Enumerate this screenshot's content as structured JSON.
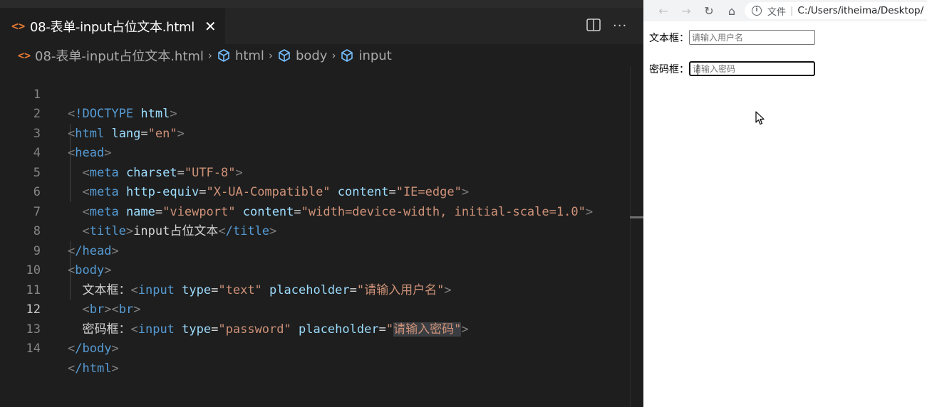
{
  "editor": {
    "tab": {
      "label": "08-表单-input占位文本.html",
      "close": "✕",
      "icon": "<>"
    },
    "more": "···",
    "breadcrumb": {
      "file_icon": "<>",
      "file": "08-表单-input占位文本.html",
      "sep": "›",
      "items": [
        "html",
        "body",
        "input"
      ]
    },
    "lines": [
      {
        "n": "1"
      },
      {
        "n": "2"
      },
      {
        "n": "3"
      },
      {
        "n": "4"
      },
      {
        "n": "5"
      },
      {
        "n": "6"
      },
      {
        "n": "7"
      },
      {
        "n": "8"
      },
      {
        "n": "9"
      },
      {
        "n": "10"
      },
      {
        "n": "11"
      },
      {
        "n": "12"
      },
      {
        "n": "13"
      },
      {
        "n": "14"
      }
    ],
    "code": {
      "l1": {
        "tag": "!DOCTYPE",
        "attr": "html"
      },
      "l2": {
        "tag": "html",
        "attr": "lang",
        "val": "\"en\""
      },
      "l3": {
        "tag": "head"
      },
      "l4": {
        "tag": "meta",
        "attr": "charset",
        "val": "\"UTF-8\""
      },
      "l5": {
        "tag": "meta",
        "attr1": "http-equiv",
        "val1": "\"X-UA-Compatible\"",
        "attr2": "content",
        "val2": "\"IE=edge\""
      },
      "l6": {
        "tag": "meta",
        "attr1": "name",
        "val1": "\"viewport\"",
        "attr2": "content",
        "val2": "\"width=device-width, initial-scale=1.0\""
      },
      "l7": {
        "tag": "title",
        "text": "input占位文本",
        "close": "/title"
      },
      "l8": {
        "tag": "/head"
      },
      "l9": {
        "tag": "body"
      },
      "l10": {
        "text": "文本框：",
        "tag": "input",
        "attr1": "type",
        "val1": "\"text\"",
        "attr2": "placeholder",
        "val2": "\"请输入用户名\""
      },
      "l11": {
        "tag1": "br",
        "tag2": "br"
      },
      "l12": {
        "text": "密码框：",
        "tag": "input",
        "attr1": "type",
        "val1": "\"password\"",
        "attr2": "placeholder",
        "val2_q": "\"",
        "val2_hl": "请输入密码\""
      },
      "l13": {
        "tag": "/body"
      },
      "l14": {
        "tag": "/html"
      }
    }
  },
  "browser": {
    "back": "←",
    "forward": "→",
    "reload": "↻",
    "home": "⌂",
    "info": "i",
    "protocol": "文件",
    "divider": "|",
    "url": "C:/Users/itheima/Desktop/",
    "form": {
      "text_label": "文本框：",
      "text_placeholder": "请输入用户名",
      "password_label": "密码框：",
      "password_placeholder": "请输入密码"
    }
  }
}
